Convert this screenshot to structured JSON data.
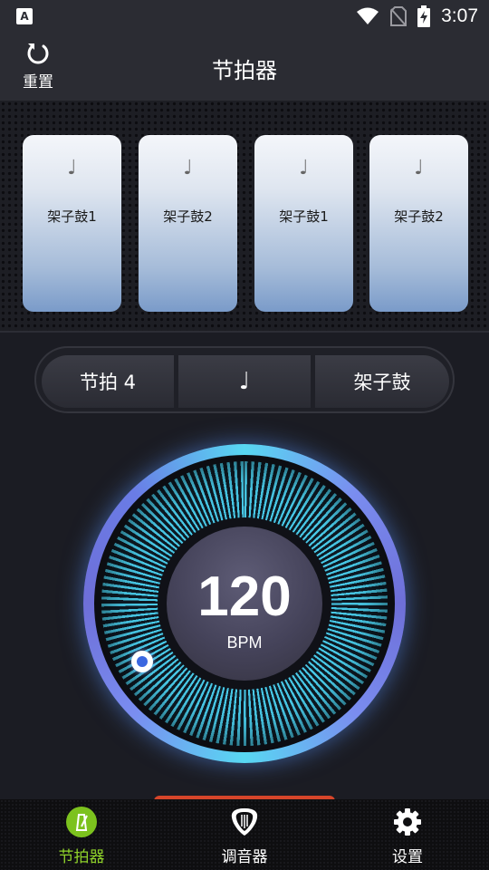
{
  "status_bar": {
    "app_badge": "A",
    "time": "3:07"
  },
  "app_bar": {
    "reset_label": "重置",
    "title": "节拍器"
  },
  "beat_cards": [
    {
      "note": "♩",
      "label": "架子鼓1"
    },
    {
      "note": "♩",
      "label": "架子鼓2"
    },
    {
      "note": "♩",
      "label": "架子鼓1"
    },
    {
      "note": "♩",
      "label": "架子鼓2"
    }
  ],
  "segments": {
    "beats": "节拍 4",
    "note": "♩",
    "instrument": "架子鼓"
  },
  "tempo": {
    "value": "120",
    "unit": "BPM"
  },
  "bottom_nav": {
    "items": [
      {
        "label": "节拍器",
        "active": true
      },
      {
        "label": "调音器",
        "active": false
      },
      {
        "label": "设置",
        "active": false
      }
    ],
    "active_color": "#8fd22a"
  }
}
